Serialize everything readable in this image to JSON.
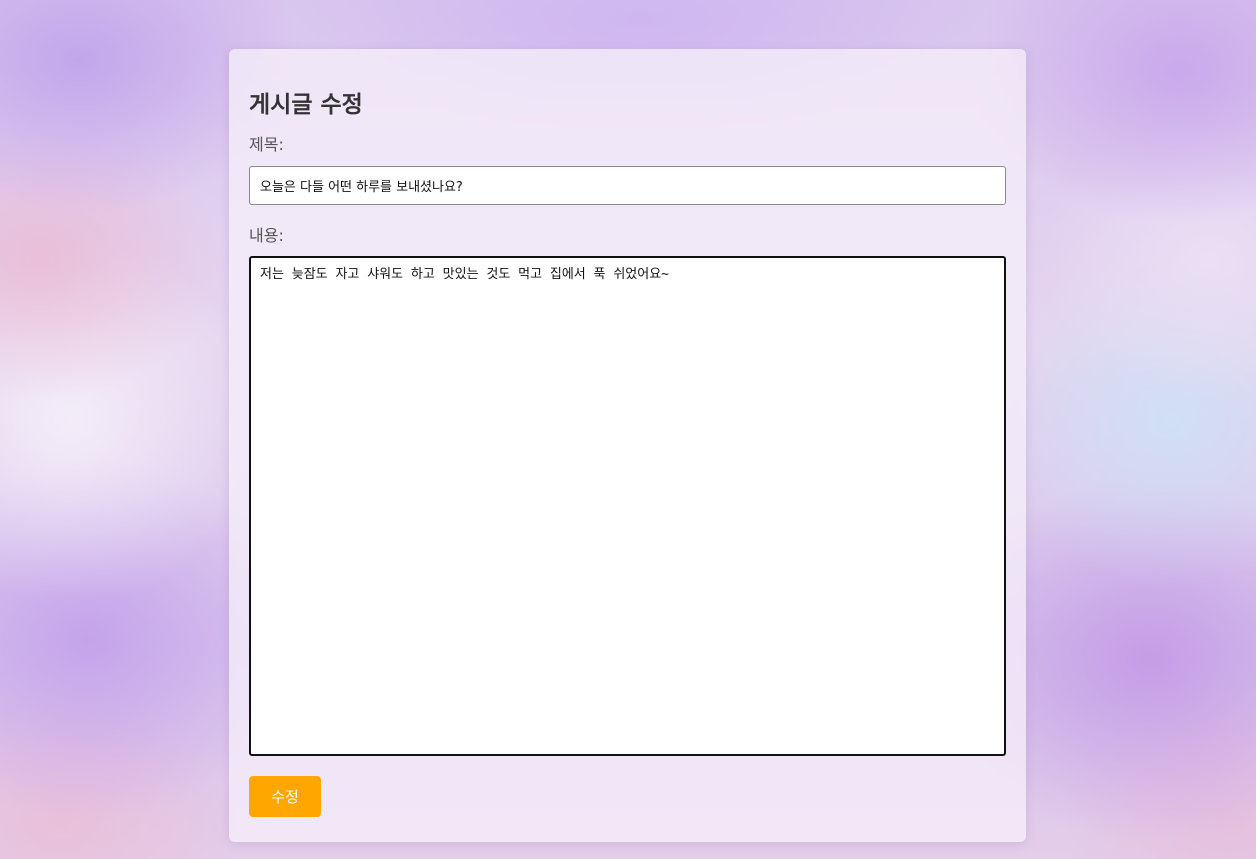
{
  "form": {
    "heading": "게시글 수정",
    "title_label": "제목:",
    "title_value": "오늘은 다들 어떤 하루를 보내셨나요?",
    "content_label": "내용:",
    "content_value": "저는 늦잠도 자고 샤워도 하고 맛있는 것도 먹고 집에서 푹 쉬었어요~",
    "submit_label": "수정"
  },
  "colors": {
    "submit_button": "#ffa600",
    "heading_text": "#333333",
    "label_text": "#555555"
  }
}
